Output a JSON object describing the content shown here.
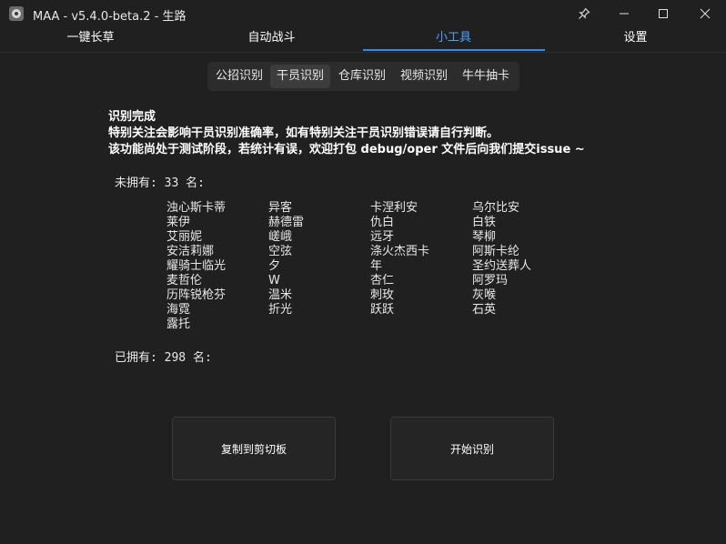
{
  "window": {
    "title": "MAA - v5.4.0-beta.2 - 生路"
  },
  "nav": {
    "tabs": [
      {
        "label": "一键长草"
      },
      {
        "label": "自动战斗"
      },
      {
        "label": "小工具"
      },
      {
        "label": "设置"
      }
    ],
    "active_index": 2
  },
  "tools": {
    "tabs": [
      {
        "label": "公招识别"
      },
      {
        "label": "干员识别"
      },
      {
        "label": "仓库识别"
      },
      {
        "label": "视频识别"
      },
      {
        "label": "牛牛抽卡"
      }
    ],
    "active_index": 1
  },
  "result": {
    "status": "识别完成",
    "note1": "特别关注会影响干员识别准确率，如有特别关注干员识别错误请自行判断。",
    "note2": "该功能尚处于测试阶段，若统计有误，欢迎打包 debug/oper 文件后向我们提交issue ~"
  },
  "not_owned": {
    "label": "未拥有: 33 名:",
    "operators": [
      "浊心斯卡蒂",
      "异客",
      "卡涅利安",
      "乌尔比安",
      "莱伊",
      "赫德雷",
      "仇白",
      "白铁",
      "艾丽妮",
      "嵯峨",
      "远牙",
      "琴柳",
      "安洁莉娜",
      "空弦",
      "涤火杰西卡",
      "阿斯卡纶",
      "耀骑士临光",
      "夕",
      "年",
      "圣约送葬人",
      "麦哲伦",
      "W",
      "杏仁",
      "阿罗玛",
      "历阵锐枪芬",
      "温米",
      "刺玫",
      "灰喉",
      "海霓",
      "折光",
      "跃跃",
      "石英",
      "露托"
    ]
  },
  "owned": {
    "label": "已拥有: 298 名:"
  },
  "buttons": {
    "copy": "复制到剪切板",
    "start": "开始识别"
  },
  "colors": {
    "background": "#202020",
    "accent": "#2d8cf0",
    "active_tab_text": "#4aa3ff"
  }
}
